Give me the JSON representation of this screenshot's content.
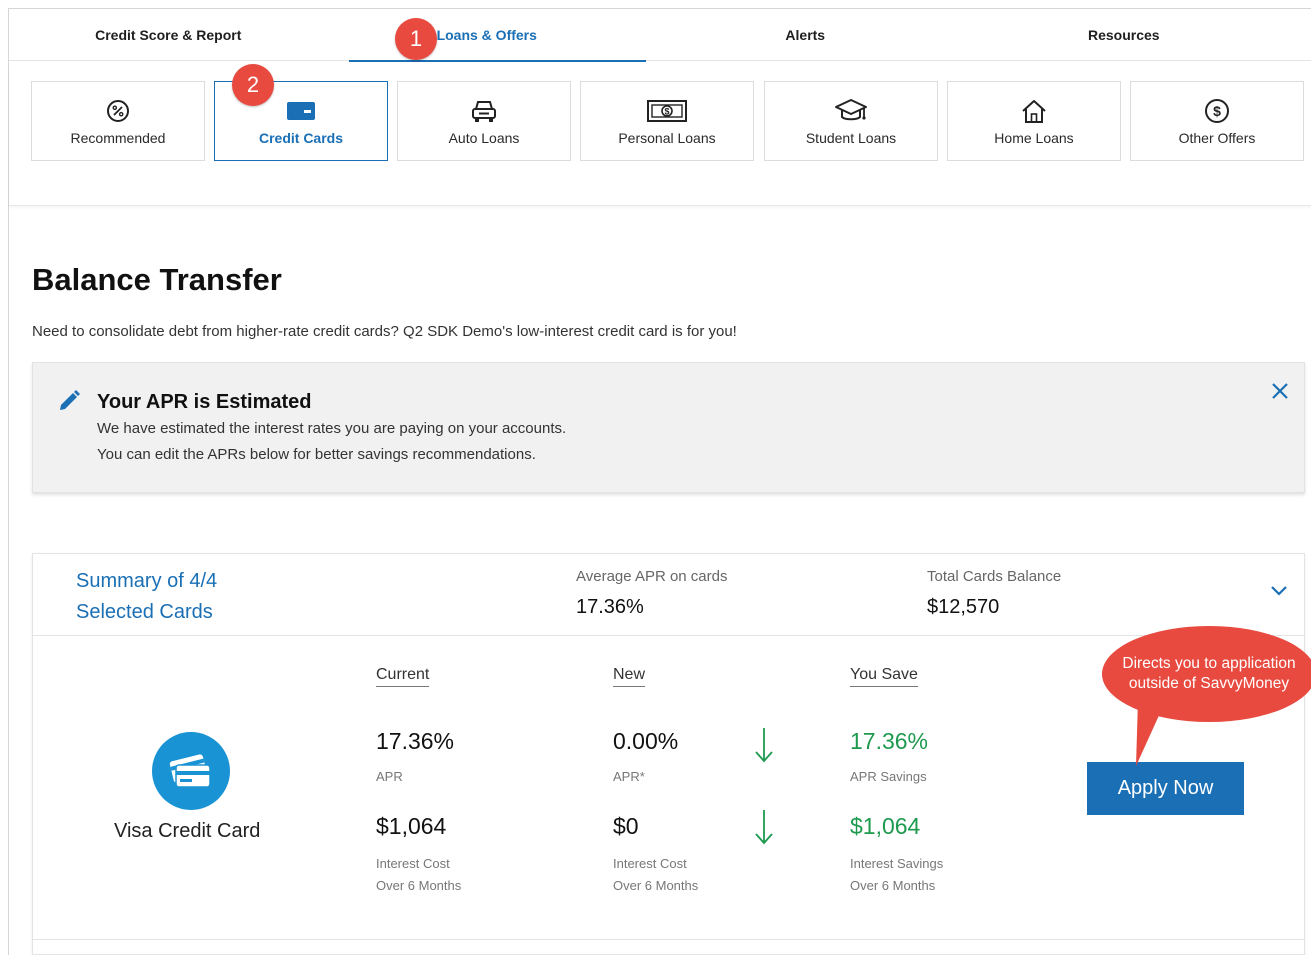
{
  "topnav": {
    "tabs": [
      {
        "label": "Credit Score & Report"
      },
      {
        "label": "Loans & Offers"
      },
      {
        "label": "Alerts"
      },
      {
        "label": "Resources"
      }
    ]
  },
  "categories": [
    {
      "label": "Recommended",
      "icon": "percent-icon"
    },
    {
      "label": "Credit Cards",
      "icon": "credit-card-icon"
    },
    {
      "label": "Auto Loans",
      "icon": "car-icon"
    },
    {
      "label": "Personal Loans",
      "icon": "cash-icon"
    },
    {
      "label": "Student Loans",
      "icon": "graduation-cap-icon"
    },
    {
      "label": "Home Loans",
      "icon": "house-icon"
    },
    {
      "label": "Other Offers",
      "icon": "dollar-circle-icon"
    }
  ],
  "callouts": {
    "one": "1",
    "two": "2",
    "apply_note": "Directs you to application outside of SavvyMoney"
  },
  "page": {
    "title": "Balance Transfer",
    "intro": "Need to consolidate debt from higher-rate credit cards? Q2 SDK Demo's low-interest credit card is for you!"
  },
  "banner": {
    "title": "Your APR is Estimated",
    "line1": "We have estimated the interest rates you are paying on your accounts.",
    "line2": "You can edit the APRs below for better savings recommendations."
  },
  "summary": {
    "title_line1": "Summary of 4/4",
    "title_line2": "Selected Cards",
    "avg_apr_label": "Average APR on cards",
    "avg_apr_value": "17.36%",
    "total_balance_label": "Total Cards Balance",
    "total_balance_value": "$12,570"
  },
  "offer": {
    "card_name": "Visa Credit Card",
    "columns": {
      "current": "Current",
      "new": "New",
      "save": "You Save"
    },
    "current": {
      "apr": "17.36%",
      "apr_label": "APR",
      "interest": "$1,064",
      "interest_label_1": "Interest Cost",
      "interest_label_2": "Over 6 Months"
    },
    "new": {
      "apr": "0.00%",
      "apr_label": "APR*",
      "interest": "$0",
      "interest_label_1": "Interest Cost",
      "interest_label_2": "Over 6 Months"
    },
    "save": {
      "apr": "17.36%",
      "apr_label": "APR Savings",
      "interest": "$1,064",
      "interest_label_1": "Interest Savings",
      "interest_label_2": "Over 6 Months"
    },
    "apply_label": "Apply Now"
  },
  "colors": {
    "accent": "#1a6fb5",
    "callout": "#e84a3f",
    "savings_green": "#1e9a4f",
    "card_icon_bg": "#1a93d4"
  }
}
